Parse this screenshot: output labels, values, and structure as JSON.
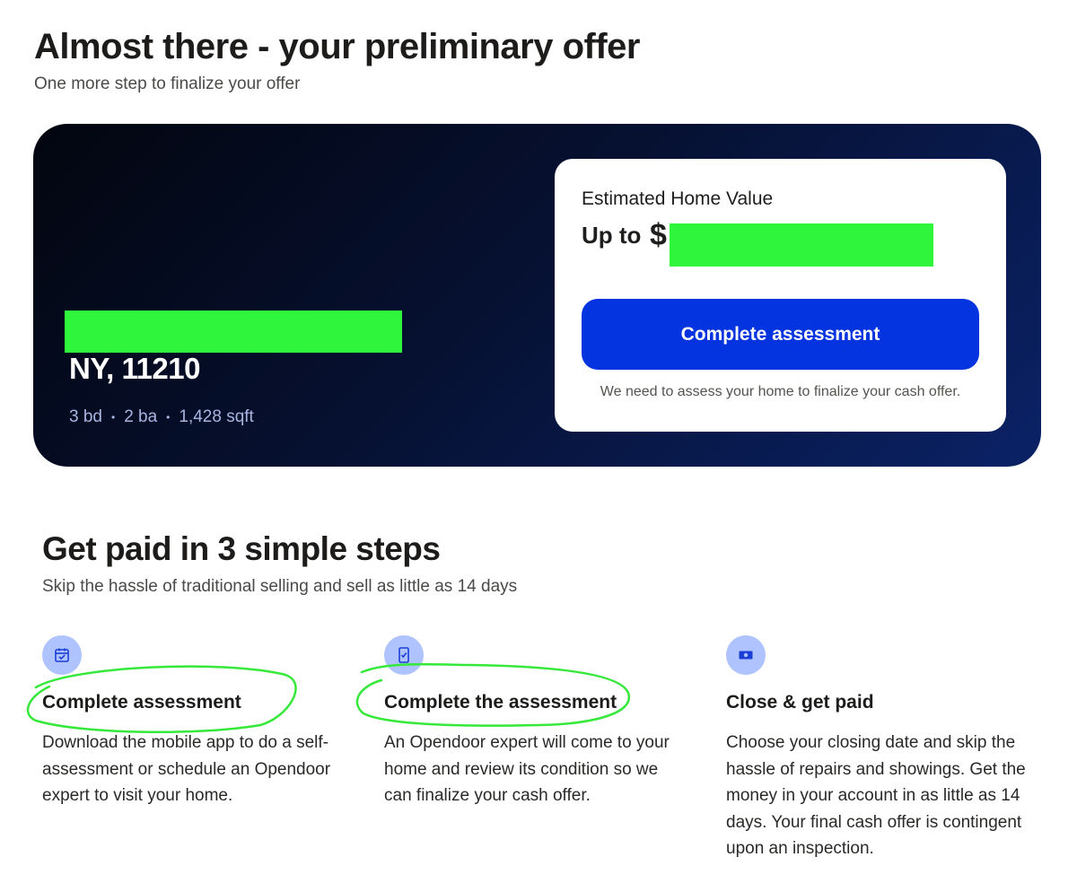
{
  "header": {
    "title": "Almost there - your preliminary offer",
    "subtitle": "One more step to finalize your offer"
  },
  "hero": {
    "address_line": "NY, 11210",
    "beds": "3 bd",
    "baths": "2 ba",
    "sqft": "1,428 sqft",
    "separator": "•"
  },
  "offer": {
    "label": "Estimated Home Value",
    "prefix": "Up to",
    "currency": "$",
    "cta_label": "Complete assessment",
    "note": "We need to assess your home to finalize your cash offer."
  },
  "steps_section": {
    "title": "Get paid in 3 simple steps",
    "subtitle": "Skip the hassle of traditional selling and sell as little as 14 days",
    "steps": [
      {
        "icon": "calendar-check-icon",
        "title": "Complete assessment",
        "text": "Download the mobile app to do a self-assessment or schedule an Opendoor expert to visit your home."
      },
      {
        "icon": "phone-check-icon",
        "title": "Complete the assessment",
        "text": "An Opendoor expert will come to your home and review its condition so we can finalize your cash offer."
      },
      {
        "icon": "cash-icon",
        "title": "Close & get paid",
        "text": "Choose your closing date and skip the hassle of repairs and showings. Get the money in your account in as little as 14 days. Your final cash offer is contingent upon an inspection."
      }
    ]
  },
  "colors": {
    "accent": "#0433e0",
    "icon_bg": "#aec3ff",
    "redaction": "#2ff53d",
    "annotation": "#35e83a"
  }
}
